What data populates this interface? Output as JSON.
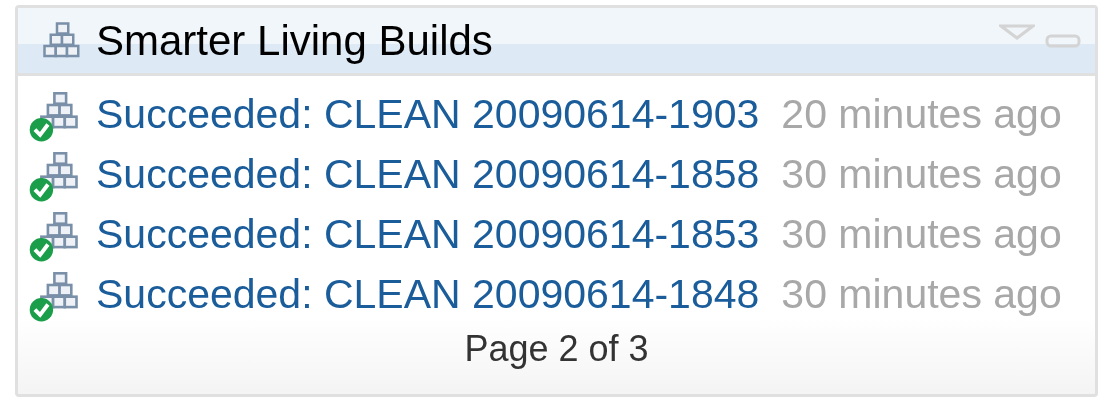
{
  "panel": {
    "title": "Smarter Living Builds"
  },
  "builds": [
    {
      "label": "Succeeded: CLEAN 20090614-1903",
      "time": "20 minutes ago",
      "succeeded": true
    },
    {
      "label": "Succeeded: CLEAN 20090614-1858",
      "time": "30 minutes ago",
      "succeeded": true
    },
    {
      "label": "Succeeded: CLEAN 20090614-1853",
      "time": "30 minutes ago",
      "succeeded": true
    },
    {
      "label": "Succeeded: CLEAN 20090614-1848",
      "time": "30 minutes ago",
      "succeeded": true
    }
  ],
  "pager": "Page 2 of 3"
}
